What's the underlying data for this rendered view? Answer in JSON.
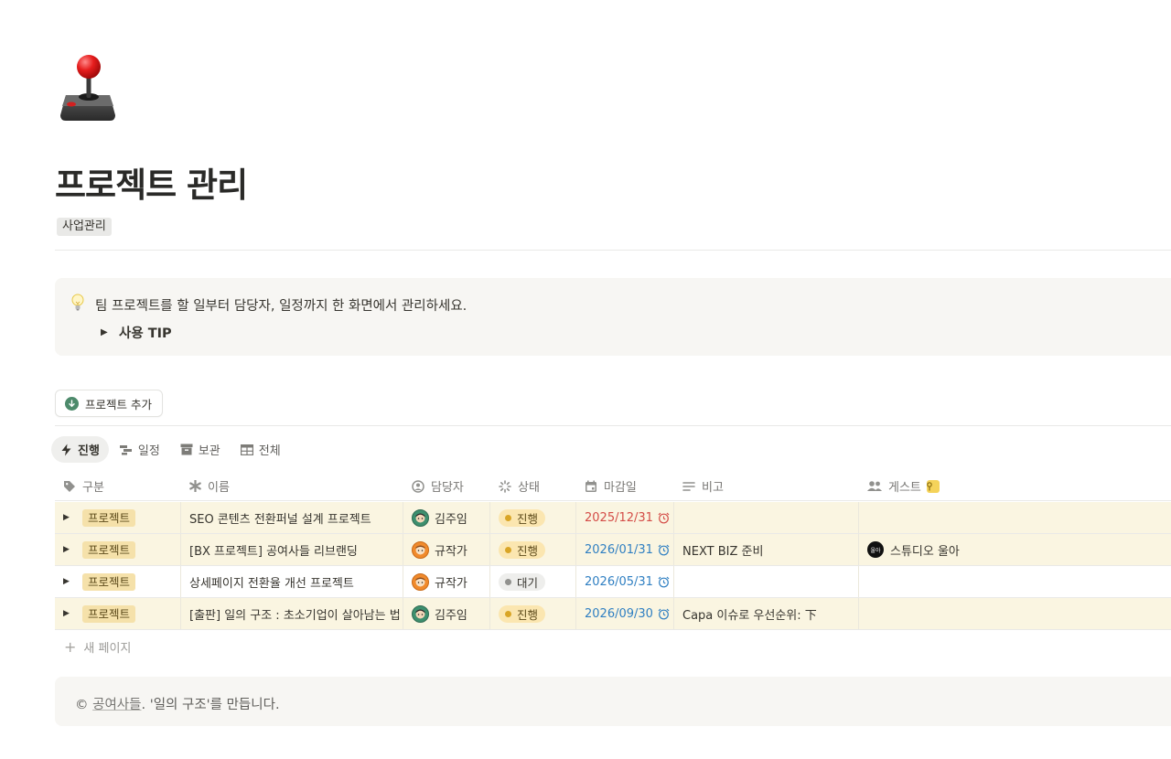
{
  "page": {
    "icon": "joystick-icon",
    "title": "프로젝트 관리",
    "tag": "사업관리"
  },
  "callout": {
    "icon": "lightbulb-icon",
    "text": "팀 프로젝트를 할 일부터 담당자, 일정까지 한 화면에서 관리하세요.",
    "toggle_label": "사용 TIP"
  },
  "add_button": {
    "label": "프로젝트 추가",
    "icon": "download-circle-icon"
  },
  "views": [
    {
      "label": "진행",
      "icon": "lightning-icon",
      "active": true
    },
    {
      "label": "일정",
      "icon": "timeline-icon",
      "active": false
    },
    {
      "label": "보관",
      "icon": "archive-icon",
      "active": false
    },
    {
      "label": "전체",
      "icon": "table-icon",
      "active": false
    }
  ],
  "columns": {
    "category": "구분",
    "name": "이름",
    "owner": "담당자",
    "status": "상태",
    "due": "마감일",
    "note": "비고",
    "guest": "게스트"
  },
  "rows": [
    {
      "category": "프로젝트",
      "name": "SEO 콘텐츠 전환퍼널 설계 프로젝트",
      "owner": "김주임",
      "status": "진행",
      "due": "2025/12/31",
      "note": "",
      "guest": ""
    },
    {
      "category": "프로젝트",
      "name": "[BX 프로젝트] 공여사들 리브랜딩",
      "owner": "규작가",
      "status": "진행",
      "due": "2026/01/31",
      "note": "NEXT BIZ 준비",
      "guest": "스튜디오 울아"
    },
    {
      "category": "프로젝트",
      "name": "상세페이지 전환율 개선 프로젝트",
      "owner": "규작가",
      "status": "대기",
      "due": "2026/05/31",
      "note": "",
      "guest": ""
    },
    {
      "category": "프로젝트",
      "name": "[출판] 일의 구조 : 초소기업이 살아남는 법",
      "owner": "김주임",
      "status": "진행",
      "due": "2026/09/30",
      "note": "Capa 이슈로 우선순위: 下",
      "guest": ""
    }
  ],
  "new_page_label": "새 페이지",
  "footer": {
    "copyright": "©",
    "link_text": "공여사들",
    "suffix": ". '일의 구조'를 만듭니다."
  },
  "guest_avatar_text": "울아",
  "colors": {
    "highlight_row": "#faf5e1",
    "tag_project": "#f5e1aa",
    "status_progress": "#fbe6b0",
    "status_wait": "#eeeeec",
    "date_overdue": "#d44c47",
    "date_future": "#2f7fc2"
  }
}
